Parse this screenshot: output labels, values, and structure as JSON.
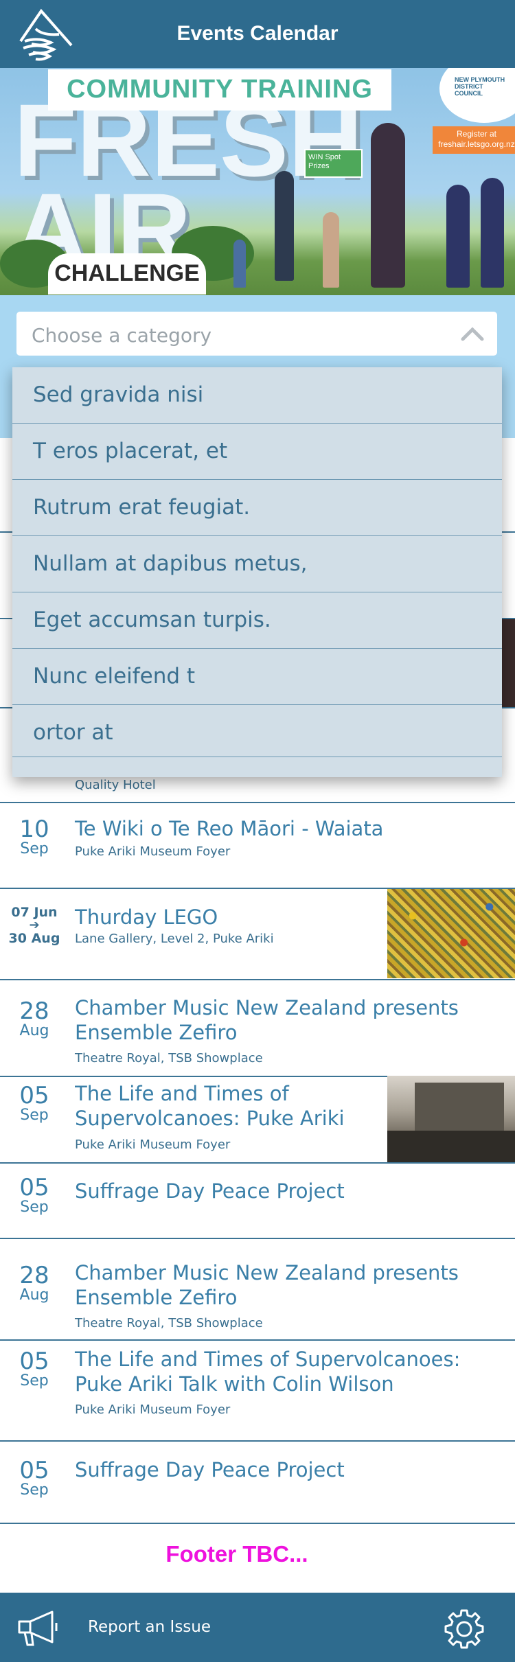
{
  "header": {
    "title": "Events Calendar"
  },
  "banner": {
    "title": "COMMUNITY TRAINING",
    "word_big": "FRESH AIR",
    "word_challenge": "CHALLENGE",
    "register_text": "Register at freshair.letsgo.org.nz",
    "council_text": "NEW PLYMOUTH DISTRICT COUNCIL",
    "win_text": "WIN Spot Prizes"
  },
  "category": {
    "placeholder": "Choose a category",
    "options": [
      "Sed gravida nisi",
      "T eros placerat, et",
      "Rutrum erat feugiat.",
      "Nullam at dapibus metus,",
      "Eget accumsan turpis.",
      "Nunc eleifend t",
      "ortor at"
    ]
  },
  "events": {
    "partial_venue": "Quality Hotel",
    "items": [
      {
        "day": "10",
        "month": "Sep",
        "title": "Te Wiki o Te Reo Māori - Waiata",
        "venue": "Puke Ariki Museum Foyer"
      },
      {
        "start": "07 Jun",
        "end": "30 Aug",
        "title": "Thurday LEGO",
        "venue": "Lane Gallery, Level 2, Puke Ariki"
      },
      {
        "day": "28",
        "month": "Aug",
        "title": "Chamber Music New Zealand presents Ensemble Zefiro",
        "venue": "Theatre Royal, TSB Showplace"
      },
      {
        "day": "05",
        "month": "Sep",
        "title": "The Life and Times of Supervolcanoes: Puke Ariki Talk with Colin Wilson",
        "venue": "Puke Ariki Museum Foyer"
      },
      {
        "day": "05",
        "month": "Sep",
        "title": "Suffrage Day Peace Project",
        "venue": ""
      },
      {
        "day": "28",
        "month": "Aug",
        "title": "Chamber Music New Zealand presents Ensemble Zefiro",
        "venue": "Theatre Royal, TSB Showplace"
      },
      {
        "day": "05",
        "month": "Sep",
        "title": "The Life and Times of Supervolcanoes: Puke Ariki Talk with Colin Wilson",
        "venue": "Puke Ariki Museum Foyer"
      },
      {
        "day": "05",
        "month": "Sep",
        "title": "Suffrage Day Peace Project",
        "venue": ""
      }
    ]
  },
  "footer": {
    "text": "Footer TBC..."
  },
  "bottom_bar": {
    "report_label": "Report an Issue"
  },
  "icons": [
    "logo-icon",
    "chevron-up-icon",
    "megaphone-icon",
    "gear-icon",
    "arrow-right-icon"
  ],
  "colors": {
    "header": "#2e6b8e",
    "category_bg": "#a8d7f2",
    "dropdown_bg": "#d1dee7",
    "footer_text": "#ee11dd",
    "accent_text": "#3a7fa8"
  }
}
